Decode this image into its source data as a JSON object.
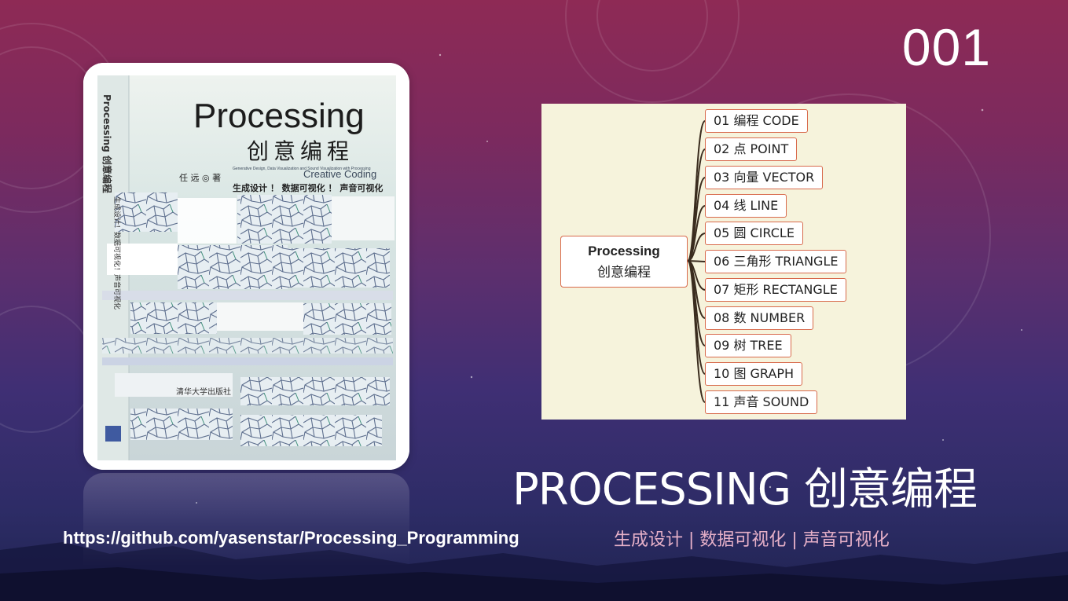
{
  "slide": {
    "number": "001",
    "title": "PROCESSING 创意编程",
    "url": "https://github.com/yasenstar/Processing_Programming",
    "subtitle": "生成设计 | 数据可视化 | 声音可视化"
  },
  "book_cover": {
    "title": "Processing",
    "chinese_title": "创意编程",
    "english_subtitle": "Creative Coding",
    "small_text": "Generative Design, Data Visualization and Sound Visualization with Processing",
    "author": "任 远 ◎ 著",
    "tagline": "生成设计 ！ 数据可视化 ！ 声音可视化",
    "spine_title": "Processing 创意编程",
    "spine_tagline": "生成设计！数据可视化！声音可视化",
    "publisher": "清华大学出版社"
  },
  "mindmap": {
    "root_en": "Processing",
    "root_zh": "创意编程",
    "items": [
      {
        "label": "01 编程 CODE"
      },
      {
        "label": "02 点 POINT"
      },
      {
        "label": "03 向量 VECTOR"
      },
      {
        "label": "04 线 LINE"
      },
      {
        "label": "05 圆 CIRCLE"
      },
      {
        "label": "06 三角形 TRIANGLE"
      },
      {
        "label": "07 矩形 RECTANGLE"
      },
      {
        "label": "08 数 NUMBER"
      },
      {
        "label": "09 树 TREE"
      },
      {
        "label": "10 图 GRAPH"
      },
      {
        "label": "11 声音 SOUND"
      }
    ]
  },
  "colors": {
    "background_top": "#8e2a55",
    "background_bottom": "#1f2350",
    "mindmap_bg": "#f6f3dc",
    "node_border": "#d86a4c",
    "subtitle": "#e6b0c8"
  }
}
